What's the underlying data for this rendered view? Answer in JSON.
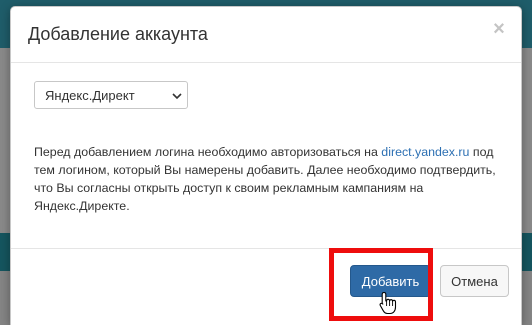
{
  "dialog": {
    "title": "Добавление аккаунта",
    "close_label": "×"
  },
  "account_select": {
    "selected_value": "Яндекс.Директ",
    "icon": "chevron-down-icon"
  },
  "info": {
    "text_before_link": "Перед добавлением логина необходимо авторизоваться на ",
    "link_text": "direct.yandex.ru",
    "text_after_link": " под тем логином, который Вы намерены добавить. Далее необходимо подтвердить, что Вы согласны открыть доступ к своим рекламным кампаниям на Яндекс.Директе."
  },
  "footer": {
    "add_button_label": "Добавить",
    "cancel_button_label": "Отмена"
  },
  "colors": {
    "primary_button": "#2e6aa6",
    "link": "#2d70b3",
    "highlight_frame": "#ee0d0d"
  },
  "pointer": {
    "icon": "hand-pointer-icon"
  }
}
